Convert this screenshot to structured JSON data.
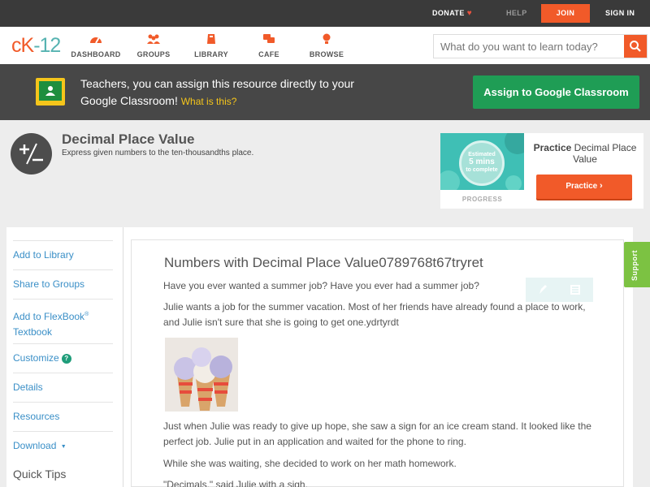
{
  "topbar": {
    "donate": "DONATE",
    "help": "HELP",
    "join": "JOIN",
    "signin": "SIGN IN"
  },
  "header": {
    "logo_left": "c",
    "logo_k": "K",
    "logo_right": "-12",
    "nav": [
      {
        "label": "DASHBOARD",
        "icon": "dashboard-icon"
      },
      {
        "label": "GROUPS",
        "icon": "groups-icon"
      },
      {
        "label": "LIBRARY",
        "icon": "library-icon"
      },
      {
        "label": "CAFE",
        "icon": "cafe-icon"
      },
      {
        "label": "BROWSE",
        "icon": "browse-icon"
      }
    ],
    "search_placeholder": "What do you want to learn today?"
  },
  "banner": {
    "text": "Teachers, you can assign this resource directly to your Google Classroom!",
    "link": "What is this?",
    "button": "Assign to Google Classroom"
  },
  "concept": {
    "title": "Decimal Place Value",
    "subtitle": "Express given numbers to the ten-thousandths place."
  },
  "practice": {
    "estimated": "Estimated",
    "mins": "5 mins",
    "to_complete": "to complete",
    "progress_label": "PROGRESS",
    "title_bold": "Practice",
    "title_rest": "Decimal Place Value",
    "button": "Practice"
  },
  "sidebar": {
    "add_library": "Add to Library",
    "share_groups": "Share to Groups",
    "add_flexbook_1": "Add to FlexBook",
    "add_flexbook_reg": "®",
    "add_flexbook_2": "Textbook",
    "customize": "Customize",
    "details": "Details",
    "resources": "Resources",
    "download": "Download",
    "download_arrow": "▼",
    "quick_tips": "Quick Tips"
  },
  "content": {
    "title": "Numbers with Decimal Place Value0789768t67tryret",
    "p1": "Have you ever wanted a summer job? Have you ever had a summer job?",
    "p2": "Julie wants a job for the summer vacation. Most of her friends have already found a place to work, and Julie isn't sure that she is going to get one.ydrtyrdt",
    "p3": "Just when Julie was ready to give up hope, she saw a sign for an ice cream stand. It looked like the perfect job. Julie put in an application and waited for the phone to ring.",
    "p4": "While she was waiting, she decided to work on her math homework.",
    "p5": "\"Decimals,\" said Julie with a sigh."
  },
  "support": "Support",
  "colors": {
    "accent_orange": "#f15a29",
    "teal": "#56b3b1",
    "green_button": "#1f9d55",
    "support_green": "#7cc242",
    "link_blue": "#3a8fc7"
  }
}
